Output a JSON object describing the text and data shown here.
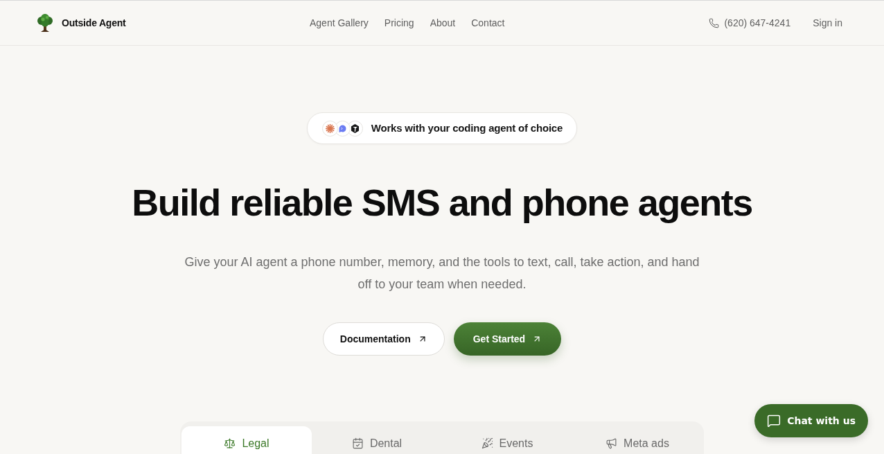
{
  "header": {
    "brand": "Outside Agent",
    "nav": [
      {
        "label": "Agent Gallery"
      },
      {
        "label": "Pricing"
      },
      {
        "label": "About"
      },
      {
        "label": "Contact"
      }
    ],
    "phone": "(620) 647-4241",
    "sign_in": "Sign in"
  },
  "hero": {
    "badge": "Works with your coding agent of choice",
    "title": "Build reliable SMS and phone agents",
    "subtitle": "Give your AI agent a phone number, memory, and the tools to text, call, take action, and hand off to your team when needed.",
    "buttons": [
      {
        "label": "Documentation",
        "kind": "secondary"
      },
      {
        "label": "Get Started",
        "kind": "primary"
      }
    ]
  },
  "tabs": [
    {
      "label": "Legal",
      "selected": true
    },
    {
      "label": "Dental",
      "selected": false
    },
    {
      "label": "Events",
      "selected": false
    },
    {
      "label": "Meta ads",
      "selected": false
    }
  ],
  "chat": {
    "label": "Chat with us"
  }
}
